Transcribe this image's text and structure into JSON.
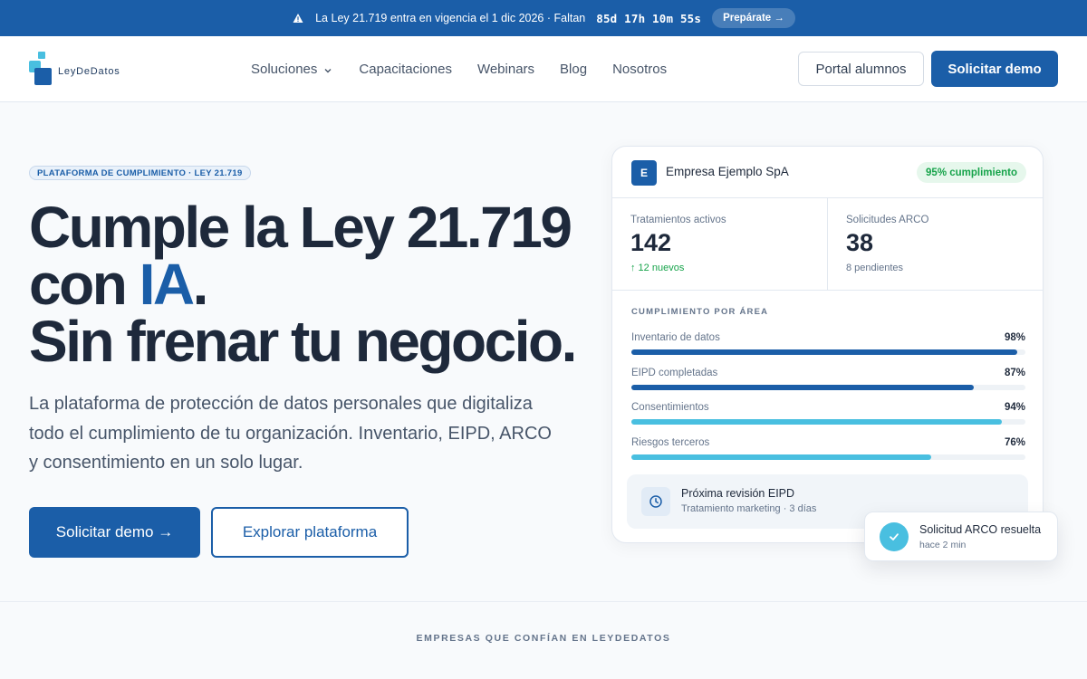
{
  "announcement": {
    "text": "La Ley 21.719 entra en vigencia el 1 dic 2026 · Faltan",
    "countdown": "85d 17h 10m 55s",
    "cta": "Prepárate →",
    "icon": "warning-icon"
  },
  "header": {
    "logo_text": "LeyDeDatos",
    "nav": [
      {
        "label": "Soluciones",
        "has_dropdown": true
      },
      {
        "label": "Capacitaciones"
      },
      {
        "label": "Webinars"
      },
      {
        "label": "Blog"
      },
      {
        "label": "Nosotros"
      }
    ],
    "portal_label": "Portal alumnos",
    "demo_label": "Solicitar demo"
  },
  "hero": {
    "badge": "PLATAFORMA DE CUMPLIMIENTO · LEY 21.719",
    "headline_line1": "Cumple la Ley 21.719",
    "headline_line2_pre": "con ",
    "headline_line2_accent": "IA",
    "headline_line2_post": ".",
    "headline_line3": "Sin frenar tu negocio.",
    "subtext": "La plataforma de protección de datos personales que digitaliza todo el cumplimiento de tu organización. Inventario, EIPD, ARCO y consentimiento en un solo lugar.",
    "primary_cta": "Solicitar demo →",
    "secondary_cta": "Explorar plataforma"
  },
  "dashboard": {
    "company_initial": "E",
    "company_name": "Empresa Ejemplo SpA",
    "compliance_badge": "95% cumplimiento",
    "stats": [
      {
        "label": "Tratamientos activos",
        "value": "142",
        "note": "↑ 12 nuevos"
      },
      {
        "label": "Solicitudes ARCO",
        "value": "38",
        "note": "8 pendientes"
      }
    ],
    "section_title": "CUMPLIMIENTO POR ÁREA",
    "areas": [
      {
        "name": "Inventario de datos",
        "pct_label": "98%",
        "pct": 98,
        "color": "#1b5ea8"
      },
      {
        "name": "EIPD completadas",
        "pct_label": "87%",
        "pct": 87,
        "color": "#1b5ea8"
      },
      {
        "name": "Consentimientos",
        "pct_label": "94%",
        "pct": 94,
        "color": "#49bfe0"
      },
      {
        "name": "Riesgos terceros",
        "pct_label": "76%",
        "pct": 76,
        "color": "#49bfe0"
      }
    ],
    "review": {
      "title": "Próxima revisión EIPD",
      "subtitle": "Tratamiento marketing · 3 días",
      "icon": "clock-icon"
    }
  },
  "toast": {
    "title": "Solicitud ARCO resuelta",
    "time": "hace 2 min",
    "icon": "check-icon"
  },
  "trust": {
    "label": "EMPRESAS QUE CONFÍAN EN LEYDEDATOS"
  },
  "colors": {
    "brand": "#1b5ea8",
    "accent": "#49bfe0",
    "success": "#16a34a"
  }
}
